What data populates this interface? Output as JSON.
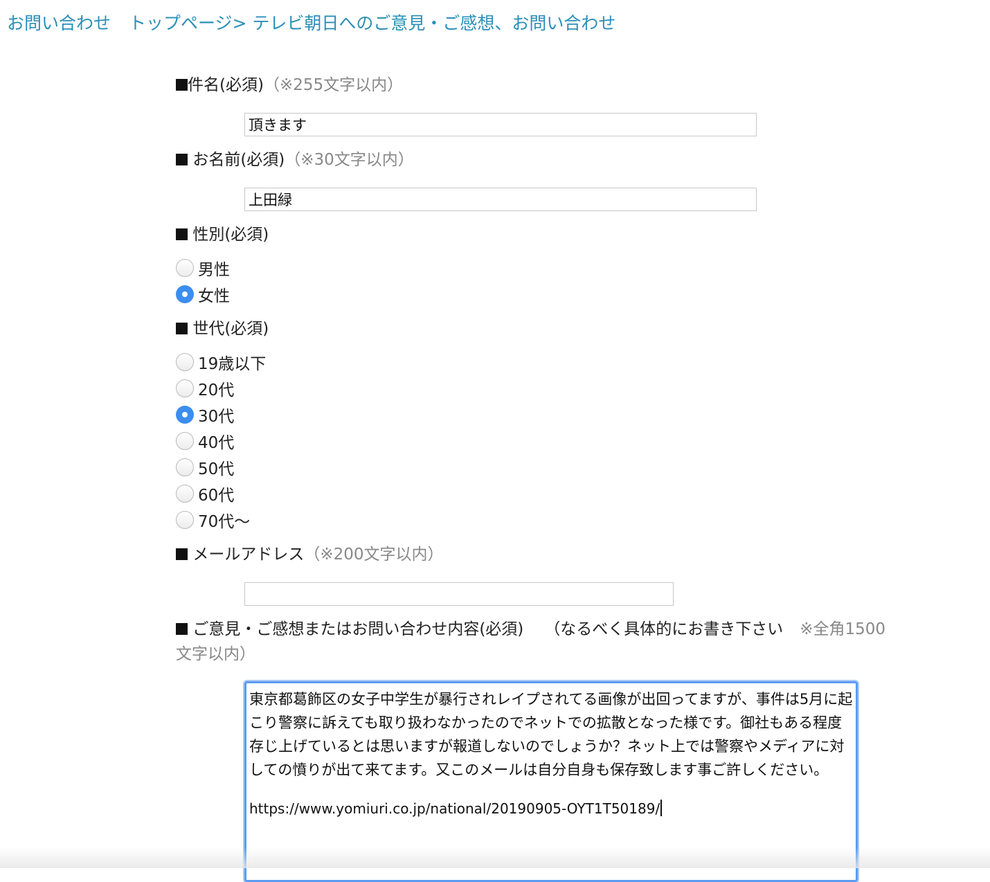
{
  "header": {
    "title": "お問い合わせ",
    "breadcrumb_home": "トップページ>",
    "breadcrumb_current": "テレビ朝日へのご意見・ご感想、お問い合わせ"
  },
  "subject": {
    "label": "件名(必須)",
    "note": "（※255文字以内）",
    "value": "頂きます"
  },
  "name": {
    "label": "お名前(必須)",
    "note": "（※30文字以内）",
    "value": "上田緑"
  },
  "gender": {
    "label": "性別(必須)",
    "options": [
      "男性",
      "女性"
    ],
    "selected": "女性"
  },
  "generation": {
    "label": "世代(必須)",
    "options": [
      "19歳以下",
      "20代",
      "30代",
      "40代",
      "50代",
      "60代",
      "70代〜"
    ],
    "selected": "30代"
  },
  "email": {
    "label": "メールアドレス",
    "note": "（※200文字以内）",
    "value": ""
  },
  "message": {
    "label": "ご意見・ご感想またはお問い合わせ内容(必須)",
    "label_hint": "（なるべく具体的にお書き下さい",
    "note_line1": "※全角1500",
    "note_line2": "文字以内）",
    "body": "東京都葛飾区の女子中学生が暴行されレイプされてる画像が出回ってますが、事件は5月に起こり警察に訴えても取り扱わなかったのでネットでの拡散となった様です。御社もある程度存じ上げているとは思いますが報道しないのでしょうか？ネット上では警察やメディアに対しての憤りが出て来てます。又このメールは自分自身も保存致します事ご許しください。",
    "url": "https://www.yomiuri.co.jp/national/20190905-OYT1T50189/"
  },
  "colors": {
    "link": "#2a8fb8",
    "note": "#888888",
    "radio_checked": "#3b8ef0",
    "focus_ring": "#5b9cf2"
  }
}
